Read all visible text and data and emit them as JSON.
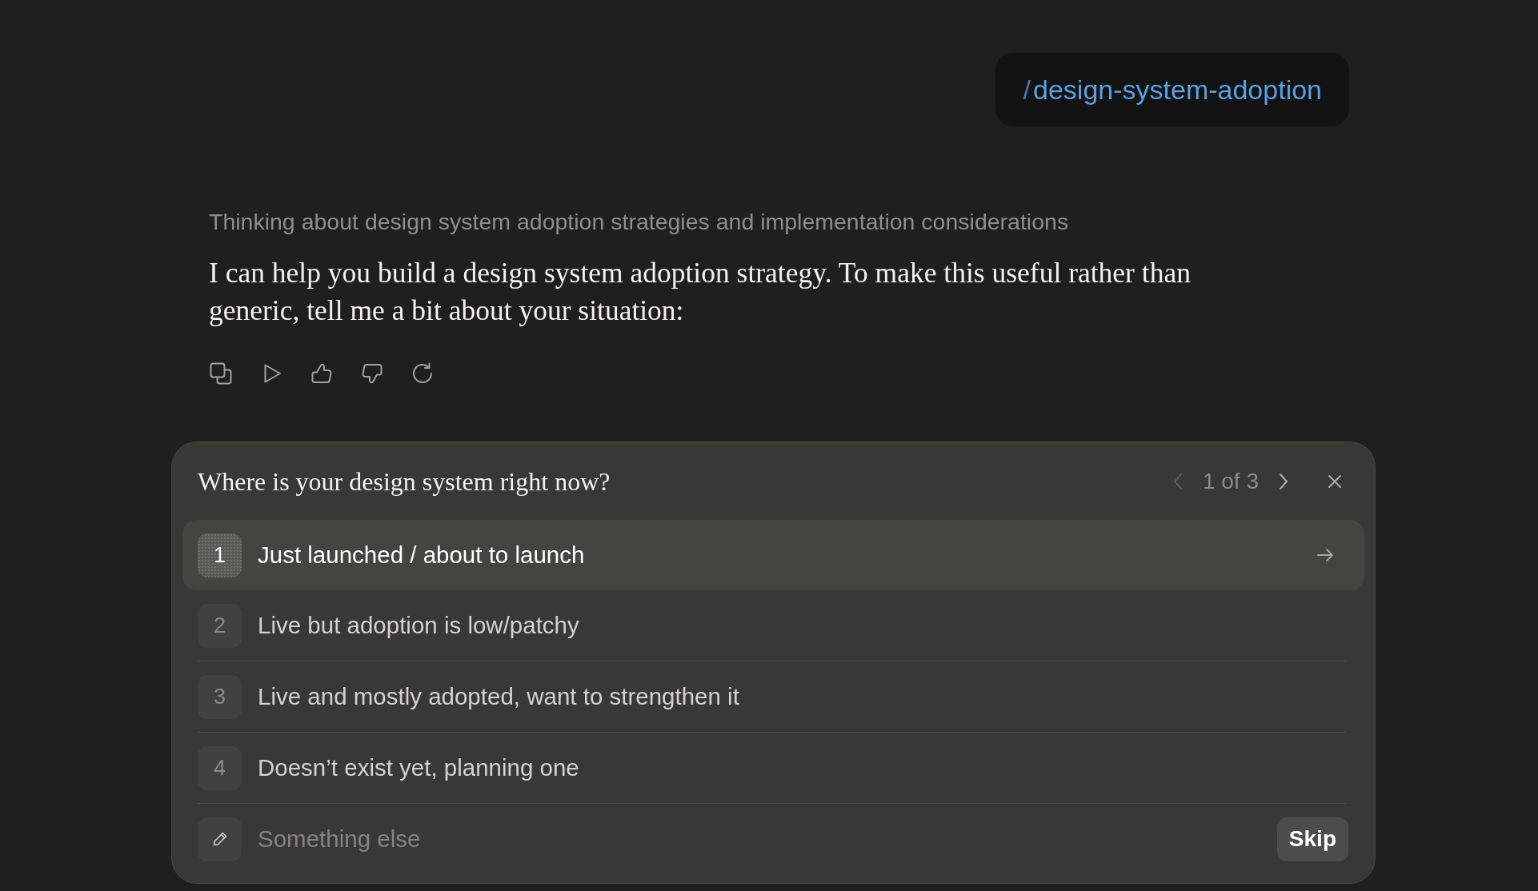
{
  "user_message": {
    "slash": "/",
    "command": "design-system-adoption"
  },
  "assistant_message": {
    "thinking": "Thinking about design system adoption strategies and implementation considerations",
    "text": "I can help you build a design system adoption strategy. To make this useful rather than generic, tell me a bit about your situation:"
  },
  "question_card": {
    "question": "Where is your design system right now?",
    "pager": {
      "label": "1 of 3",
      "previous_disabled": true,
      "next_disabled": false
    },
    "options": [
      {
        "number": "1",
        "label": "Just launched / about to launch",
        "selected": true
      },
      {
        "number": "2",
        "label": "Live but adoption is low/patchy",
        "selected": false
      },
      {
        "number": "3",
        "label": "Live and mostly adopted, want to strengthen it",
        "selected": false
      },
      {
        "number": "4",
        "label": "Doesn’t exist yet, planning one",
        "selected": false
      }
    ],
    "other_answer": {
      "placeholder": "Something else"
    },
    "skip_button": "Skip"
  }
}
